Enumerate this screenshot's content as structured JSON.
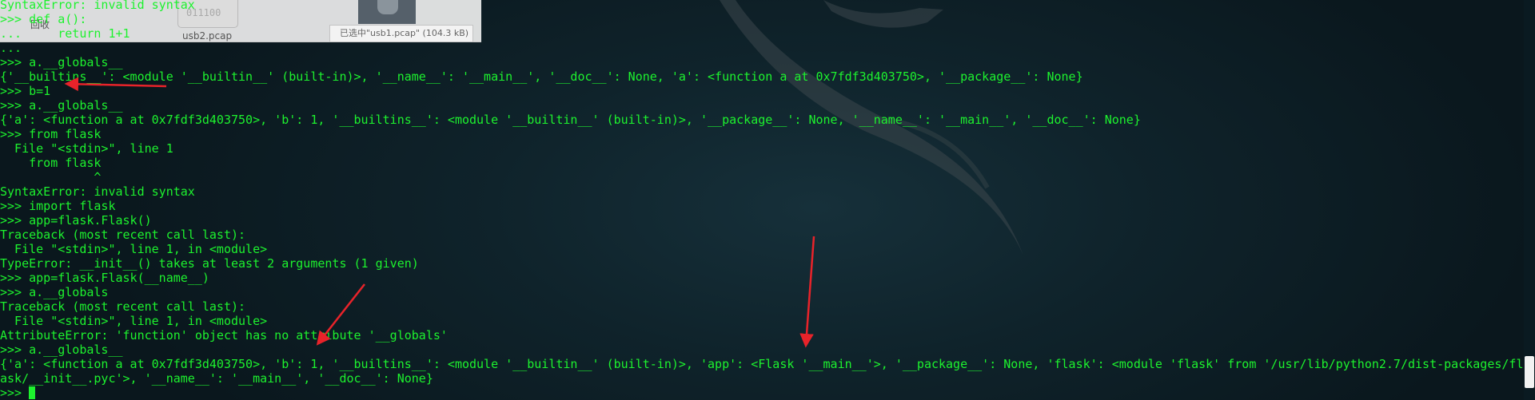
{
  "taskbar": {
    "thumb1_text": "011100",
    "label_recycle": "回收",
    "label_file": "usb2.pcap",
    "selected_status": "已选中\"usb1.pcap\" (104.3 kB)"
  },
  "terminal": {
    "lines": [
      "SyntaxError: invalid syntax",
      ">>> def a():",
      "...     return 1+1",
      "...",
      ">>> a.__globals__",
      "{'__builtins__': <module '__builtin__' (built-in)>, '__name__': '__main__', '__doc__': None, 'a': <function a at 0x7fdf3d403750>, '__package__': None}",
      ">>> b=1",
      ">>> a.__globals__",
      "{'a': <function a at 0x7fdf3d403750>, 'b': 1, '__builtins__': <module '__builtin__' (built-in)>, '__package__': None, '__name__': '__main__', '__doc__': None}",
      ">>> from flask",
      "  File \"<stdin>\", line 1",
      "    from flask",
      "             ^",
      "SyntaxError: invalid syntax",
      ">>> import flask",
      ">>> app=flask.Flask()",
      "Traceback (most recent call last):",
      "  File \"<stdin>\", line 1, in <module>",
      "TypeError: __init__() takes at least 2 arguments (1 given)",
      ">>> app=flask.Flask(__name__)",
      ">>> a.__globals",
      "Traceback (most recent call last):",
      "  File \"<stdin>\", line 1, in <module>",
      "AttributeError: 'function' object has no attribute '__globals'",
      ">>> a.__globals__",
      "{'a': <function a at 0x7fdf3d403750>, 'b': 1, '__builtins__': <module '__builtin__' (built-in)>, 'app': <Flask '__main__'>, '__package__': None, 'flask': <module 'flask' from '/usr/lib/python2.7/dist-packages/fl",
      "ask/__init__.pyc'>, '__name__': '__main__', '__doc__': None}"
    ],
    "prompt": ">>> "
  },
  "colors": {
    "terminal_text": "#1df22e",
    "annotation_arrow": "#e8232a",
    "background": "#0f232b"
  }
}
